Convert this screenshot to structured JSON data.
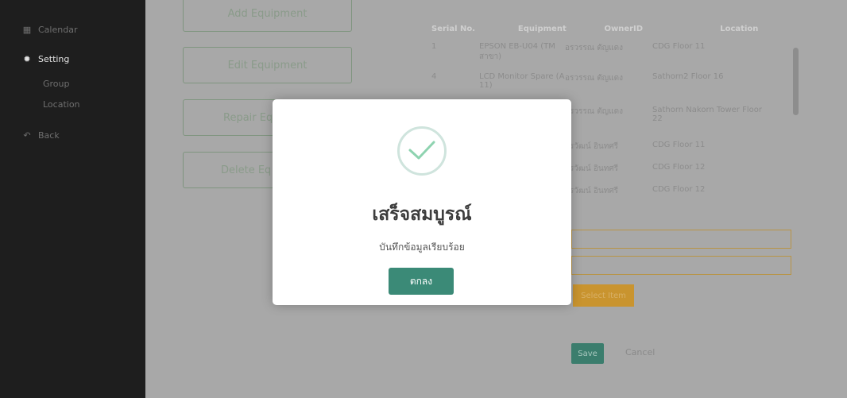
{
  "sidebar": {
    "calendar": "Calendar",
    "setting": "Setting",
    "group": "Group",
    "location": "Location",
    "back": "Back"
  },
  "equipment_buttons": {
    "add": "Add Equipment",
    "edit": "Edit Equipment",
    "repair": "Repair Eq",
    "delete": "Delete Eq"
  },
  "table": {
    "headers": [
      "Serial No.",
      "Equipment",
      "OwnerID",
      "Location"
    ],
    "rows": [
      {
        "serial": "1",
        "equipment": "EPSON EB-U04 (TM สาขา)",
        "owner": "อรวรรณ ตัญแดง",
        "location": "CDG Floor 11"
      },
      {
        "serial": "4",
        "equipment": "LCD Monitor Spare (A 11)",
        "owner": "อรวรรณ ตัญแดง",
        "location": "Sathorn2 Floor 16"
      },
      {
        "serial": "",
        "equipment": "",
        "owner": "อรวรรณ ตัญแดง",
        "location": "Sathorn Nakorn Tower Floor 22"
      },
      {
        "serial": "",
        "equipment": "",
        "owner": "จีรวัฒน์ อินทศรี",
        "location": "CDG Floor 11"
      },
      {
        "serial": "",
        "equipment": "",
        "owner": "จีรวัฒน์ อินทศรี",
        "location": "CDG Floor 12"
      },
      {
        "serial": "",
        "equipment": "",
        "owner": "จีรวัฒน์ อินทศรี",
        "location": "CDG Floor 12"
      }
    ]
  },
  "form": {
    "orange_button": "Select Item",
    "save": "Save",
    "cancel": "Cancel"
  },
  "modal": {
    "title": "เสร็จสมบูรณ์",
    "message": "บันทึกข้อมูลเรียบร้อย",
    "ok": "ตกลง"
  }
}
